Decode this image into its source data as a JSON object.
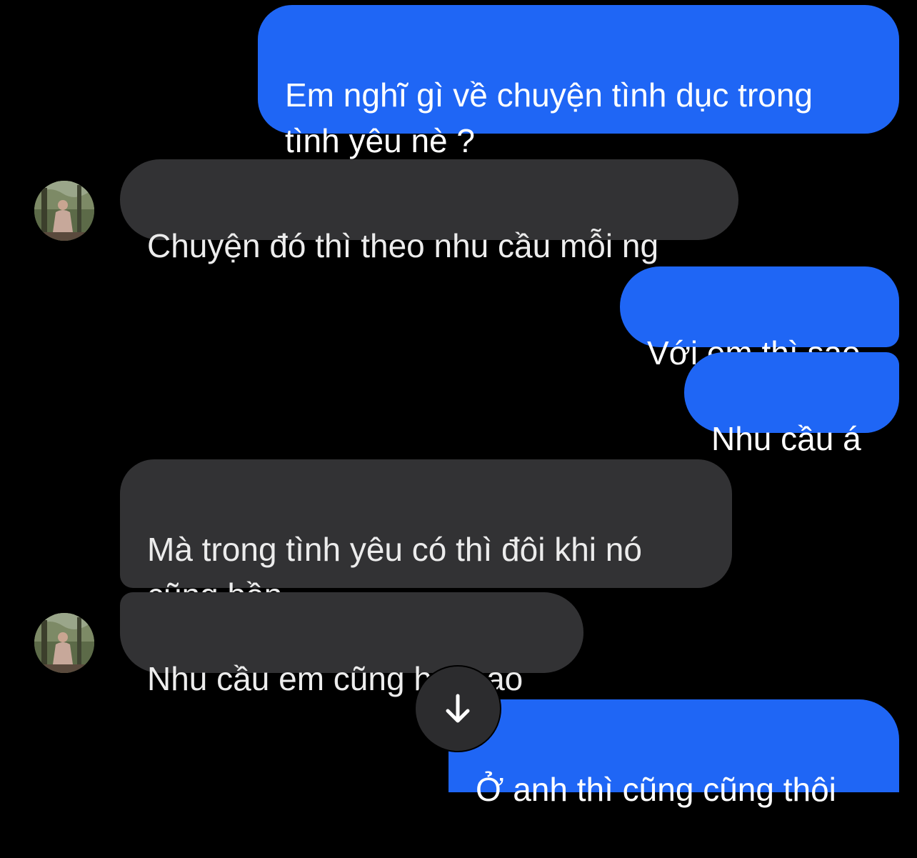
{
  "colors": {
    "background": "#000000",
    "outgoing_bubble": "#1f66f5",
    "incoming_bubble": "#323234",
    "scroll_button": "#2c2c2e"
  },
  "messages": [
    {
      "direction": "outgoing",
      "text": "Em nghĩ gì về chuyện tình dục trong\ntình yêu nè ?"
    },
    {
      "direction": "incoming",
      "text": "Chuyện đó thì theo nhu cầu mỗi ng"
    },
    {
      "direction": "outgoing",
      "text": "Với em thì sao"
    },
    {
      "direction": "outgoing",
      "text": "Nhu cầu á"
    },
    {
      "direction": "incoming",
      "text": "Mà trong tình yêu có thì đôi khi nó\ncũng bền"
    },
    {
      "direction": "incoming",
      "text": "Nhu cầu em cũng hơi cao"
    },
    {
      "direction": "outgoing",
      "text": "Ở anh thì cũng cũng thôi"
    }
  ],
  "scroll_to_bottom": {
    "icon": "arrow-down-icon"
  }
}
